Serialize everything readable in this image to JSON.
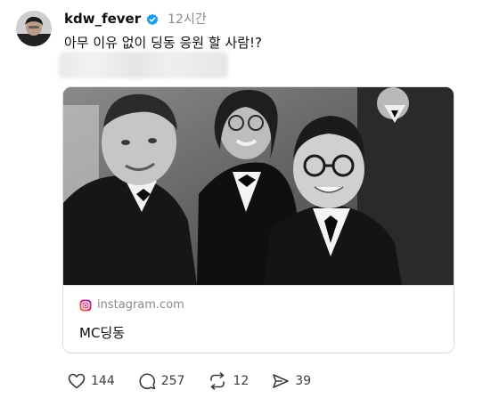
{
  "post": {
    "username": "kdw_fever",
    "verified": true,
    "timestamp": "12시간",
    "caption": "아무 이유 없이 딩동 응원 할 사람!?"
  },
  "link_card": {
    "source": "instagram.com",
    "source_icon": "instagram-icon",
    "title": "MC딩동"
  },
  "actions": {
    "like_count": "144",
    "comment_count": "257",
    "repost_count": "12",
    "share_count": "39"
  },
  "colors": {
    "verified_badge": "#1d9bf0",
    "instagram_gradient_start": "#f58529",
    "instagram_gradient_end": "#8134af"
  }
}
